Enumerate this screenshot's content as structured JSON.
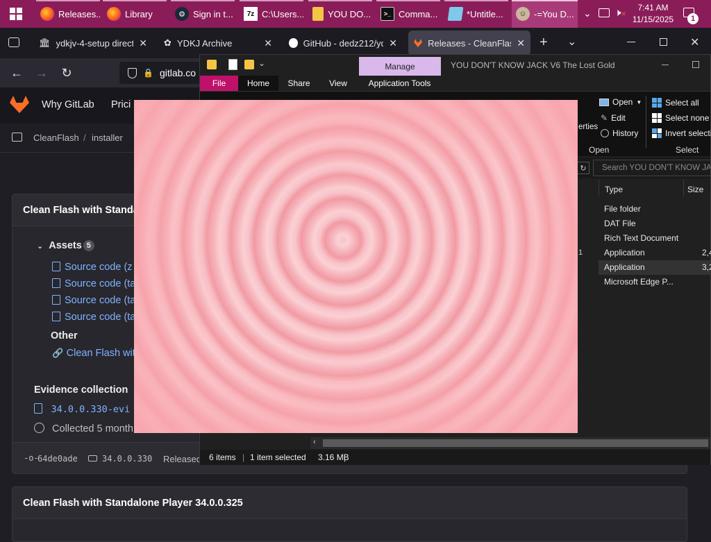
{
  "taskbar": {
    "items": [
      {
        "label": "Releases...",
        "icon": "firefox-icon"
      },
      {
        "label": "Library",
        "icon": "firefox-icon"
      },
      {
        "label": "Sign in t...",
        "icon": "steam-icon"
      },
      {
        "label": "C:\\Users...",
        "icon": "7zip-icon"
      },
      {
        "label": "YOU DO...",
        "icon": "folder-icon"
      },
      {
        "label": "Comma...",
        "icon": "terminal-icon"
      },
      {
        "label": "*Untitle...",
        "icon": "notepad-icon"
      },
      {
        "label": "-=You D...",
        "icon": "ydkj-icon"
      }
    ],
    "time": "7:41 AM",
    "date": "11/15/2025",
    "notification_count": "1"
  },
  "browser": {
    "tabs": [
      {
        "label": "ydkjv-4-setup directory"
      },
      {
        "label": "YDKJ Archive"
      },
      {
        "label": "GitHub - dedz212/ydkj"
      },
      {
        "label": "Releases - CleanFlash /"
      }
    ],
    "address": "gitlab.co"
  },
  "gitlab": {
    "nav": [
      "Why GitLab",
      "Prici"
    ],
    "breadcrumb": [
      "CleanFlash",
      "installer"
    ],
    "release1": {
      "title": "Clean Flash with Standa",
      "assets_label": "Assets",
      "assets_count": "5",
      "assets": [
        "Source code (z",
        "Source code (ta",
        "Source code (ta",
        "Source code (ta"
      ],
      "other_label": "Other",
      "other_link": "Clean Flash wit",
      "evidence_label": "Evidence collection",
      "evidence_file": "34.0.0.330-evi",
      "collected": "Collected 5 month",
      "commit": "64de0ade",
      "tag": "34.0.0.330",
      "released": "Released"
    },
    "release2": {
      "title": "Clean Flash with Standalone Player 34.0.0.325"
    }
  },
  "explorer": {
    "title": "YOU DON'T KNOW JACK V6 The Lost Gold",
    "manage_label": "Manage",
    "ribbon_tabs": [
      "File",
      "Home",
      "Share",
      "View",
      "Application Tools"
    ],
    "properties_fragment": "erties",
    "open_group": {
      "open": "Open",
      "edit": "Edit",
      "history": "History",
      "label": "Open"
    },
    "select_group": {
      "select_all": "Select all",
      "select_none": "Select none",
      "invert": "Invert selectio",
      "label": "Select"
    },
    "search_placeholder": "Search YOU DON'T KNOW JA...",
    "columns": {
      "type": "Type",
      "size": "Size"
    },
    "rows": [
      {
        "type": "File folder",
        "size": ""
      },
      {
        "type": "DAT File",
        "size": ""
      },
      {
        "type": "Rich Text Document",
        "size": ""
      },
      {
        "type": "Application",
        "size": "2,4"
      },
      {
        "type": "Application",
        "size": "3,2"
      },
      {
        "type": "Microsoft Edge P...",
        "size": ""
      }
    ],
    "status": {
      "items": "6 items",
      "selected": "1 item selected",
      "size": "3.16 MB"
    }
  },
  "colors": {
    "taskbar": "#8a1d59",
    "gitlab_bg": "#1f1e24",
    "explorer_bg": "#202020",
    "file_tab": "#c0116a",
    "overlay": "#f7b3bb"
  }
}
